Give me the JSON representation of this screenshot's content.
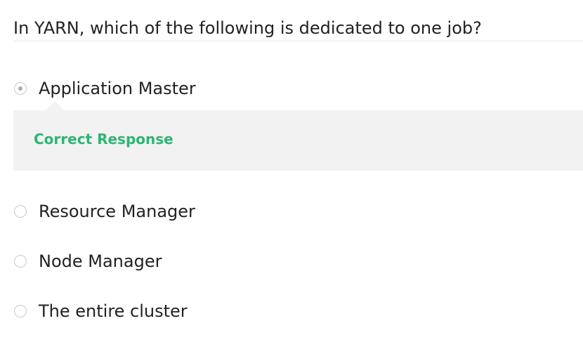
{
  "question": "In YARN, which of the following is dedicated to one job?",
  "options": [
    {
      "label": "Application Master",
      "selected": true
    },
    {
      "label": "Resource Manager",
      "selected": false
    },
    {
      "label": "Node Manager",
      "selected": false
    },
    {
      "label": "The entire cluster",
      "selected": false
    }
  ],
  "feedback": {
    "text": "Correct Response",
    "color": "#2bb673"
  }
}
